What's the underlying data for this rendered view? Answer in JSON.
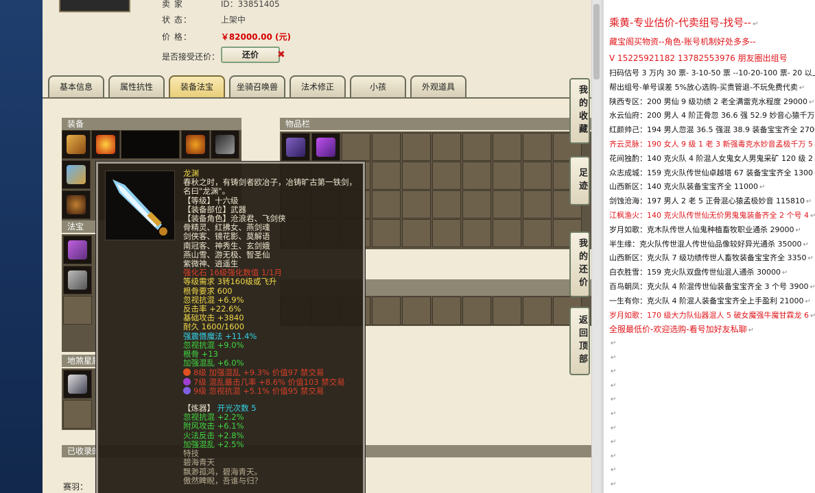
{
  "game": {
    "seller_label": "卖 家",
    "seller_id": "ID：33851405",
    "status_label": "状        态：",
    "status_value": "上架中",
    "price_label": "价        格：",
    "price_value": "￥82000.00 (元)",
    "counter_label": "是否接受还价：",
    "counter_button": "还价",
    "tabs": [
      "基本信息",
      "属性抗性",
      "装备法宝",
      "坐骑召唤兽",
      "法术修正",
      "小孩",
      "外观道具"
    ],
    "active_tab": "装备法宝",
    "sections": {
      "equipment": "装备",
      "inventory": "物品栏",
      "treasure": "法宝",
      "earth_star": "地煞星属",
      "collected": "已收录的",
      "bottom_label": "赛羽："
    },
    "side_buttons": [
      "我的收藏",
      "足迹",
      "我的还价",
      "返回顶部"
    ]
  },
  "tooltip": {
    "name": "龙渊",
    "desc": "春秋之时，有铸剑者欧冶子，冶铸旷古第一铁剑，名曰\"龙渊\"。",
    "level": "【等级】十六级",
    "type": "【装备部位】武器",
    "roles": "【装备角色】沧浪君、飞剑侠",
    "roles2": "骨精灵、红拂女、燕剑魂",
    "roles3": "剑侠客、镜花影、莫解语",
    "roles4": "南冠客、神秀生、玄剑娥",
    "roles5": "燕山雪、游无极、智圣仙",
    "roles6": "紫微神、逍遥生",
    "enhance": "强化石 16级强化数值 1/1月",
    "req_level": "等级需求 3转160级或飞升",
    "req_bone": "根骨要求 600",
    "s1": "忽视抗混 +6.9%",
    "s2": "反击率 +22.6%",
    "s3": "基础攻击 +3840",
    "s4": "耐久 1600/1600",
    "b1": "强震慑魔法 +11.4%",
    "b2": "忽视抗混 +9.0%",
    "b3": "根骨 +13",
    "b4": "加强混乱 +6.0%",
    "gem1": "8级 加强混乱 +9.3% 价值97 禁交易",
    "gem2": "7级 混乱最击几率 +8.6% 价值103 禁交易",
    "gem3": "9级 忽视抗混 +5.1% 价值95 禁交易",
    "forge": "【炼器】",
    "forge_count": "开光次数 5",
    "f1": "忽视抗混 +2.2%",
    "f2": "附风攻击 +6.1%",
    "f3": "火法反击 +2.8%",
    "f4": "加强混乱 +2.5%",
    "special": "特技",
    "sp1": "碧海青天",
    "sp2": "飘渺孤鸿，碧海青天。",
    "sp3": "傲然睥睨，吾谁与归？"
  },
  "doc": {
    "title": "乘黄-专业估价-代卖组号-找号--",
    "sub1": "藏宝阁买物资--角色-账号机制好处多多--",
    "sub2": "V 15225921182   13782553976 朋友圈出组号",
    "lines": [
      {
        "t": "扫码估号 3 万内 30 票- 3-10-50 票  --10-20-100 票- 20 以上",
        "red": false
      },
      {
        "t": "帮出组号-单号误差 5%放心选购-买贵管退-不玩免费代卖",
        "red": false
      },
      {
        "t": "陕西专区：200 男仙 9 级功绩 2 老全满雷克水程度 29000",
        "red": false
      },
      {
        "t": "水云仙府：200 男人 4 阶正骨忽 36.6 强 52.9 妙音心猿千万",
        "red": false
      },
      {
        "t": "红颜帅己：194 男人忽混 36.5 强混 38.9 装备宝宝齐全 2700",
        "red": false
      },
      {
        "t": "齐云灵脉：190 女人 9 级 1 老 3 新强毒克水妙音孟极千万 5",
        "red": true
      },
      {
        "t": "花间独酌：140 克火队 4 阶混人女鬼女人男鬼采矿 120 级 2",
        "red": false
      },
      {
        "t": "众志成城：159 克火队传世仙卓越塔 67 装备宝宝齐全 1300",
        "red": false
      },
      {
        "t": "山西新区：140 克火队装备宝宝齐全 11000",
        "red": false
      },
      {
        "t": "剑蚀沧海：197 男人 2 老 5 正骨混心猿孟极妙音 115810",
        "red": false
      },
      {
        "t": "江枫渔火：140 克火队传世仙无价男鬼鬼装备齐全 2 个号 4",
        "red": true
      },
      {
        "t": "岁月如歌：克木队传世人仙鬼种植畜牧职业通杀 29000",
        "red": false
      },
      {
        "t": "半生缘：克火队传世混人传世仙品像较好异光通杀 35000",
        "red": false
      },
      {
        "t": "山西新区：克火队 7 级功绩传世人畜牧装备宝宝齐全 3350",
        "red": false
      },
      {
        "t": "白衣胜雪：159 克火队双盘传世仙混人通杀 30000",
        "red": false
      },
      {
        "t": "百鸟朝凤：克火队 4 阶混传世仙装备宝宝齐全 3 个号 3900",
        "red": false
      },
      {
        "t": "一生有你：克火队 4 阶混人装备宝宝齐全上手盈利 21000",
        "red": false
      },
      {
        "t": "岁月如歌：170 级大力队仙器混人 5 破女魔强牛魔甘霖龙 6",
        "red": true
      }
    ],
    "footer": "全服最低价-欢迎选购-看号加好友私聊",
    "return_mark": "↵"
  },
  "colors": {
    "accent_red": "#e0161b",
    "tab_active": "#e9cf7a",
    "tooltip_bg": "#262018"
  }
}
